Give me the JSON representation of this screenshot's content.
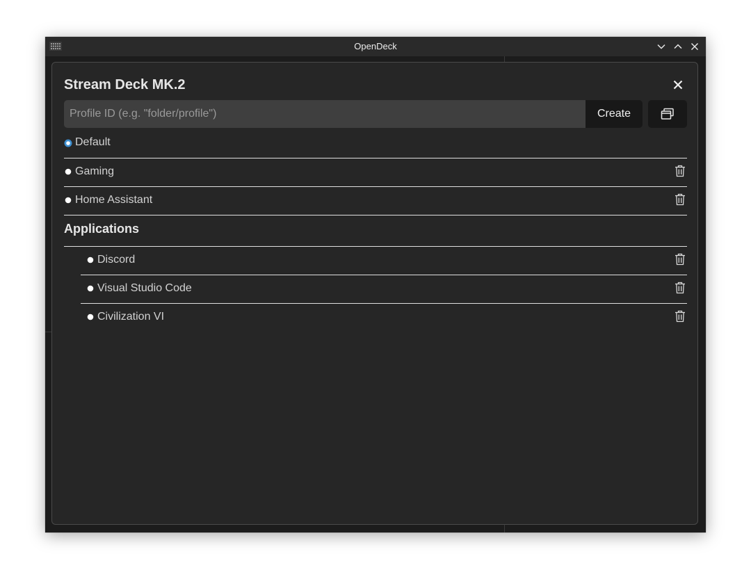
{
  "window": {
    "title": "OpenDeck"
  },
  "dialog": {
    "title": "Stream Deck MK.2",
    "input": {
      "placeholder": "Profile ID (e.g. \"folder/profile\")",
      "value": ""
    },
    "create_label": "Create",
    "profiles": [
      {
        "label": "Default",
        "selected": true
      },
      {
        "label": "Gaming",
        "selected": false
      },
      {
        "label": "Home Assistant",
        "selected": false
      }
    ],
    "applications_heading": "Applications",
    "applications": [
      {
        "label": "Discord",
        "selected": false
      },
      {
        "label": "Visual Studio Code",
        "selected": false
      },
      {
        "label": "Civilization VI",
        "selected": false
      }
    ]
  },
  "colors": {
    "accent": "#3d8fd1",
    "background": "#262626",
    "input": "#3f3f3f",
    "button": "#181818"
  },
  "icons": [
    "app-grid-icon",
    "chevron-down-icon",
    "chevron-up-icon",
    "close-icon",
    "windows-icon",
    "trash-icon"
  ]
}
